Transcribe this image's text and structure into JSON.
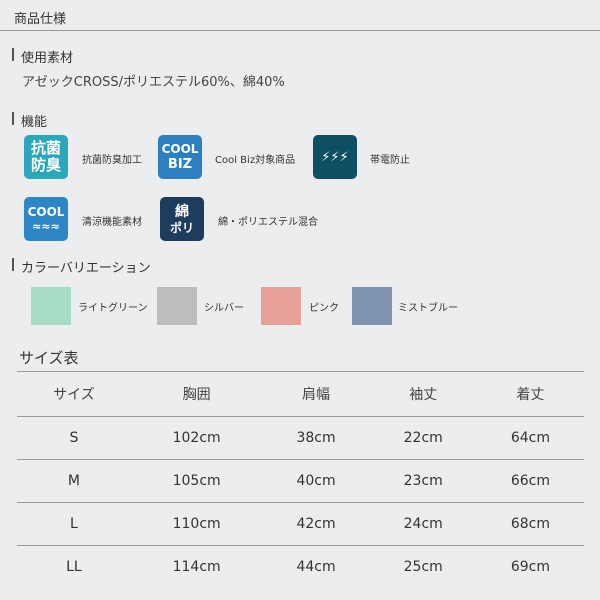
{
  "header": {
    "title": "商品仕様"
  },
  "material": {
    "heading": "使用素材",
    "text": "アゼックCROSS/ポリエステル60%、綿40%"
  },
  "function": {
    "heading": "機能",
    "icons": [
      {
        "glyph_top": "抗菌",
        "glyph_bottom": "防臭",
        "label": "抗菌防臭加工",
        "color": "#2aa7b8"
      },
      {
        "glyph_top": "COOL",
        "glyph_bottom": "BIZ",
        "label": "Cool Biz対象商品",
        "color": "#2c7fc3"
      },
      {
        "glyph_top": "⚡⚡⚡",
        "glyph_bottom": "",
        "label": "帯電防止",
        "color": "#0e4f63"
      },
      {
        "glyph_top": "COOL",
        "glyph_bottom": "",
        "label": "清涼機能素材",
        "color": "#2d86c5"
      },
      {
        "glyph_top": "綿",
        "glyph_bottom": "ポリ",
        "label": "綿・ポリエステル混合",
        "color": "#1d3c5e"
      }
    ]
  },
  "colors": {
    "heading": "カラーバリエーション",
    "items": [
      {
        "name": "ライトグリーン",
        "color": "#a9dcc4"
      },
      {
        "name": "シルバー",
        "color": "#bcbdbf"
      },
      {
        "name": "ピンク",
        "color": "#e8a199"
      },
      {
        "name": "ミストブルー",
        "color": "#7e93ad"
      }
    ]
  },
  "size_table": {
    "title": "サイズ表",
    "headers": [
      "サイズ",
      "胸囲",
      "肩幅",
      "袖丈",
      "着丈"
    ],
    "rows": [
      [
        "S",
        "102cm",
        "38cm",
        "22cm",
        "64cm"
      ],
      [
        "M",
        "105cm",
        "40cm",
        "23cm",
        "66cm"
      ],
      [
        "L",
        "110cm",
        "42cm",
        "24cm",
        "68cm"
      ],
      [
        "LL",
        "114cm",
        "44cm",
        "25cm",
        "69cm"
      ]
    ]
  }
}
